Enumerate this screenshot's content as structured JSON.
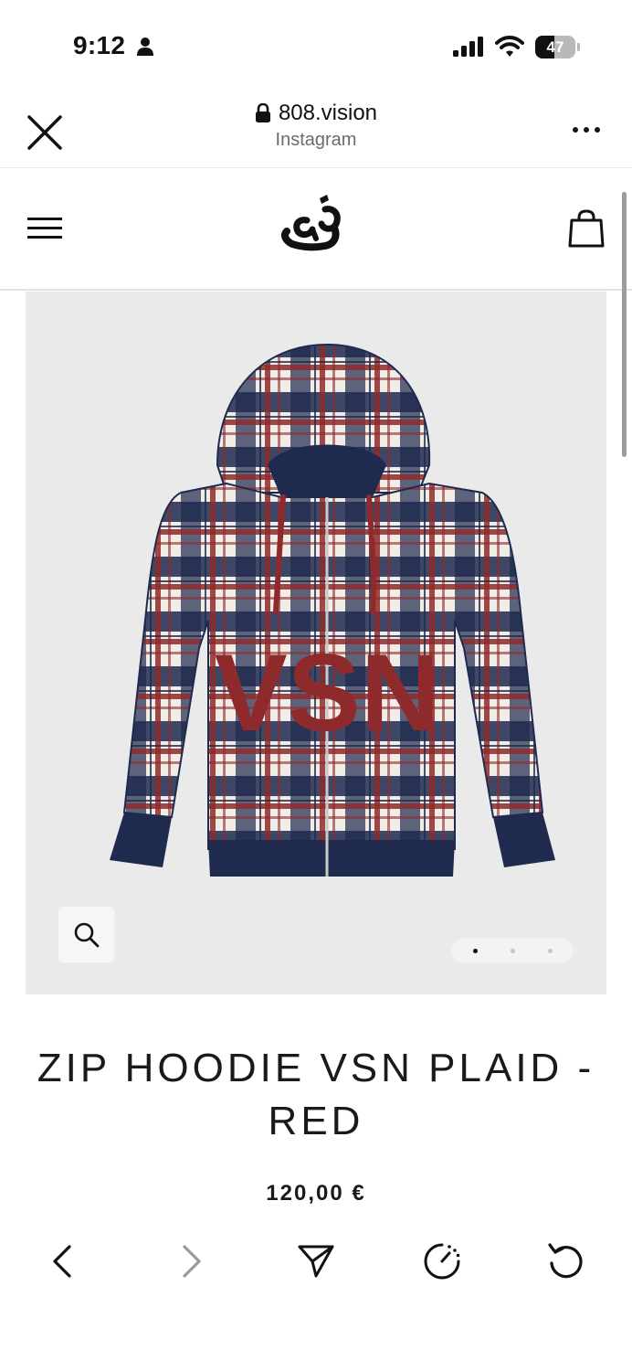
{
  "status_bar": {
    "time": "9:12",
    "battery_level": "47",
    "battery_fraction": 0.47,
    "icons": [
      "person-icon",
      "cellular-signal-icon",
      "wifi-icon",
      "battery-icon"
    ]
  },
  "browser": {
    "url": "808.vision",
    "subtitle": "Instagram",
    "icons": [
      "close-icon",
      "lock-icon",
      "more-icon"
    ]
  },
  "site_header": {
    "icons": [
      "hamburger-menu-icon",
      "brand-logo",
      "shopping-bag-icon"
    ]
  },
  "gallery": {
    "image": "plaid-zip-hoodie-photo",
    "image_colors": {
      "navy": "#1f2a4f",
      "red": "#8e2a2c",
      "white": "#f1ece6"
    },
    "print_text": "VSN",
    "slide_count": 3,
    "active_slide": 1,
    "icons": [
      "magnifier-icon"
    ]
  },
  "product": {
    "title": "ZIP HOODIE VSN PLAID - RED",
    "price": "120,00 €"
  },
  "toolbar": {
    "icons": [
      "back-icon",
      "forward-icon",
      "share-icon",
      "dashed-timer-icon",
      "reload-icon"
    ]
  },
  "colors": {
    "text": "#111111",
    "muted": "#6b6b6b",
    "gallery_bg": "#eaeaea"
  }
}
